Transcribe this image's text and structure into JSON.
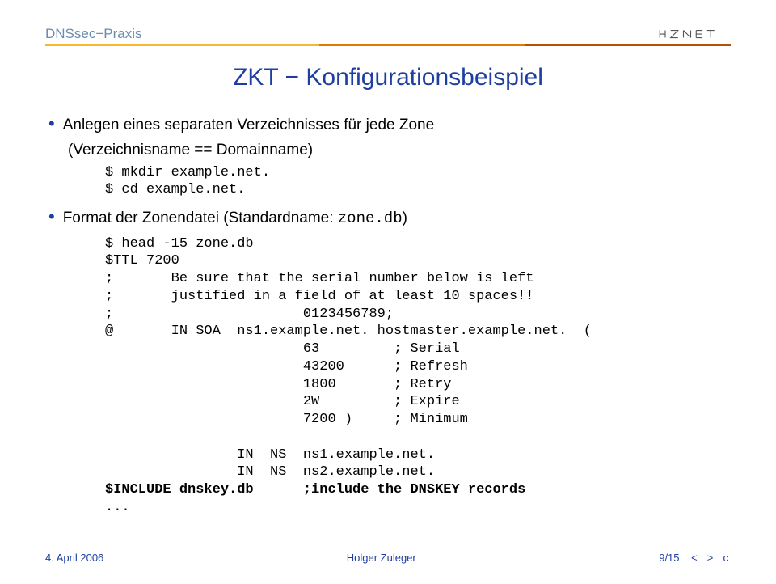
{
  "header": {
    "section": "DNSsec−Praxis",
    "logo_text": "HZNET"
  },
  "title": "ZKT − Konfigurationsbeispiel",
  "bullets": {
    "b1": {
      "text": "Anlegen eines separaten Verzeichnisses für jede Zone",
      "sub": "(Verzeichnisname == Domainname)"
    },
    "code1_l1": "$ mkdir example.net.",
    "code1_l2": "$ cd example.net.",
    "b2": {
      "prefix": "Format der Zonendatei (Standardname: ",
      "mono": "zone.db",
      "suffix": ")"
    },
    "code2": "$ head -15 zone.db\n$TTL 7200\n;       Be sure that the serial number below is left\n;       justified in a field of at least 10 spaces!!\n;                       0123456789;\n@       IN SOA  ns1.example.net. hostmaster.example.net.  (\n                        63         ; Serial\n                        43200      ; Refresh\n                        1800       ; Retry\n                        2W         ; Expire\n                        7200 )     ; Minimum\n\n                IN  NS  ns1.example.net.\n                IN  NS  ns2.example.net.\n",
    "code2_bold": "$INCLUDE dnskey.db      ;include the DNSKEY records",
    "code2_tail": "..."
  },
  "footer": {
    "left": "4. April 2006",
    "center": "Holger Zuleger",
    "right": "9/15",
    "nav": "< > c"
  }
}
